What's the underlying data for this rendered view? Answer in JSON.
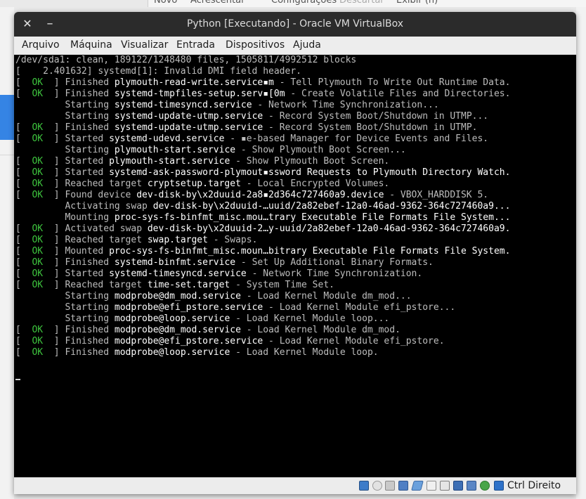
{
  "background": {
    "menu_items": [
      "Novo",
      "Acrescentar",
      "Configurações",
      "Descartar",
      "Exibir (h)"
    ]
  },
  "window": {
    "title": "Python [Executando] - Oracle VM VirtualBox",
    "close_glyph": "✕",
    "minimize_glyph": "–"
  },
  "menubar": {
    "items": [
      "Arquivo",
      "Máquina",
      "Visualizar",
      "Entrada",
      "Dispositivos",
      "Ajuda"
    ]
  },
  "console": {
    "lines": [
      {
        "type": "plain",
        "text": "/dev/sda1: clean, 189122/1248480 files, 1505811/4992512 blocks"
      },
      {
        "type": "plain",
        "text": "[    2.401632] systemd[1]: Invalid DMI field header."
      },
      {
        "type": "ok",
        "verb": "Finished",
        "unit": "plymouth-read-write.service▪m",
        "desc": " - Tell Plymouth To Write Out Runtime Data."
      },
      {
        "type": "ok",
        "verb": "Finished",
        "unit": "systemd-tmpfiles-setup.serv▪[0m",
        "desc": " - Create Volatile Files and Directories."
      },
      {
        "type": "pending",
        "verb": "Starting",
        "unit": "systemd-timesyncd.service",
        "desc": " - Network Time Synchronization..."
      },
      {
        "type": "pending",
        "verb": "Starting",
        "unit": "systemd-update-utmp.service",
        "desc": " - Record System Boot/Shutdown in UTMP..."
      },
      {
        "type": "ok",
        "verb": "Finished",
        "unit": "systemd-update-utmp.service",
        "desc": " - Record System Boot/Shutdown in UTMP."
      },
      {
        "type": "ok",
        "verb": "Started",
        "unit": "systemd-udevd.service",
        "desc": " - ▪e-based Manager for Device Events and Files."
      },
      {
        "type": "pending",
        "verb": "Starting",
        "unit": "plymouth-start.service",
        "desc": " - Show Plymouth Boot Screen..."
      },
      {
        "type": "ok",
        "verb": "Started",
        "unit": "plymouth-start.service",
        "desc": " - Show Plymouth Boot Screen."
      },
      {
        "type": "ok",
        "verb": "Started",
        "unit": "systemd-ask-password-plymout▪ssword Requests to Plymouth Directory Watch.",
        "desc": ""
      },
      {
        "type": "ok",
        "verb": "Reached target",
        "unit": "cryptsetup.target",
        "desc": " - Local Encrypted Volumes."
      },
      {
        "type": "ok",
        "verb": "Found device",
        "unit": "dev-disk-by\\x2duuid-2a8▪2d364c727460a9.device",
        "desc": " - VBOX_HARDDISK 5."
      },
      {
        "type": "pending",
        "verb": "Activating swap",
        "unit": "dev-disk-by\\x2duuid-…uuid/2a82ebef-12a0-46ad-9362-364c727460a9...",
        "desc": ""
      },
      {
        "type": "pending",
        "verb": "Mounting",
        "unit": "proc-sys-fs-binfmt_misc.mou…trary Executable File Formats File System...",
        "desc": ""
      },
      {
        "type": "ok",
        "verb": "Activated swap",
        "unit": "dev-disk-by\\x2duuid-2…y-uuid/2a82ebef-12a0-46ad-9362-364c727460a9.",
        "desc": ""
      },
      {
        "type": "ok",
        "verb": "Reached target",
        "unit": "swap.target",
        "desc": " - Swaps."
      },
      {
        "type": "ok",
        "verb": "Mounted",
        "unit": "proc-sys-fs-binfmt_misc.moun…bitrary Executable File Formats File System.",
        "desc": ""
      },
      {
        "type": "ok",
        "verb": "Finished",
        "unit": "systemd-binfmt.service",
        "desc": " - Set Up Additional Binary Formats."
      },
      {
        "type": "ok",
        "verb": "Started",
        "unit": "systemd-timesyncd.service",
        "desc": " - Network Time Synchronization."
      },
      {
        "type": "ok",
        "verb": "Reached target",
        "unit": "time-set.target",
        "desc": " - System Time Set."
      },
      {
        "type": "pending",
        "verb": "Starting",
        "unit": "modprobe@dm_mod.service",
        "desc": " - Load Kernel Module dm_mod..."
      },
      {
        "type": "pending",
        "verb": "Starting",
        "unit": "modprobe@efi_pstore.service",
        "desc": " - Load Kernel Module efi_pstore..."
      },
      {
        "type": "pending",
        "verb": "Starting",
        "unit": "modprobe@loop.service",
        "desc": " - Load Kernel Module loop..."
      },
      {
        "type": "ok",
        "verb": "Finished",
        "unit": "modprobe@dm_mod.service",
        "desc": " - Load Kernel Module dm_mod."
      },
      {
        "type": "ok",
        "verb": "Finished",
        "unit": "modprobe@efi_pstore.service",
        "desc": " - Load Kernel Module efi_pstore."
      },
      {
        "type": "ok",
        "verb": "Finished",
        "unit": "modprobe@loop.service",
        "desc": " - Load Kernel Module loop."
      },
      {
        "type": "blank",
        "text": ""
      },
      {
        "type": "cursor",
        "text": ""
      }
    ],
    "ok_label": " OK ",
    "ok_color": "#3ec43e"
  },
  "statusbar": {
    "icons": [
      "hard-disk-icon",
      "optical-drive-icon",
      "audio-icon",
      "network-icon",
      "usb-icon",
      "shared-folders-icon",
      "display-icon",
      "video-capture-icon",
      "cpu-icon",
      "mouse-integration-icon",
      "host-key-arrow-icon"
    ],
    "host_key_label": "Ctrl Direito"
  }
}
